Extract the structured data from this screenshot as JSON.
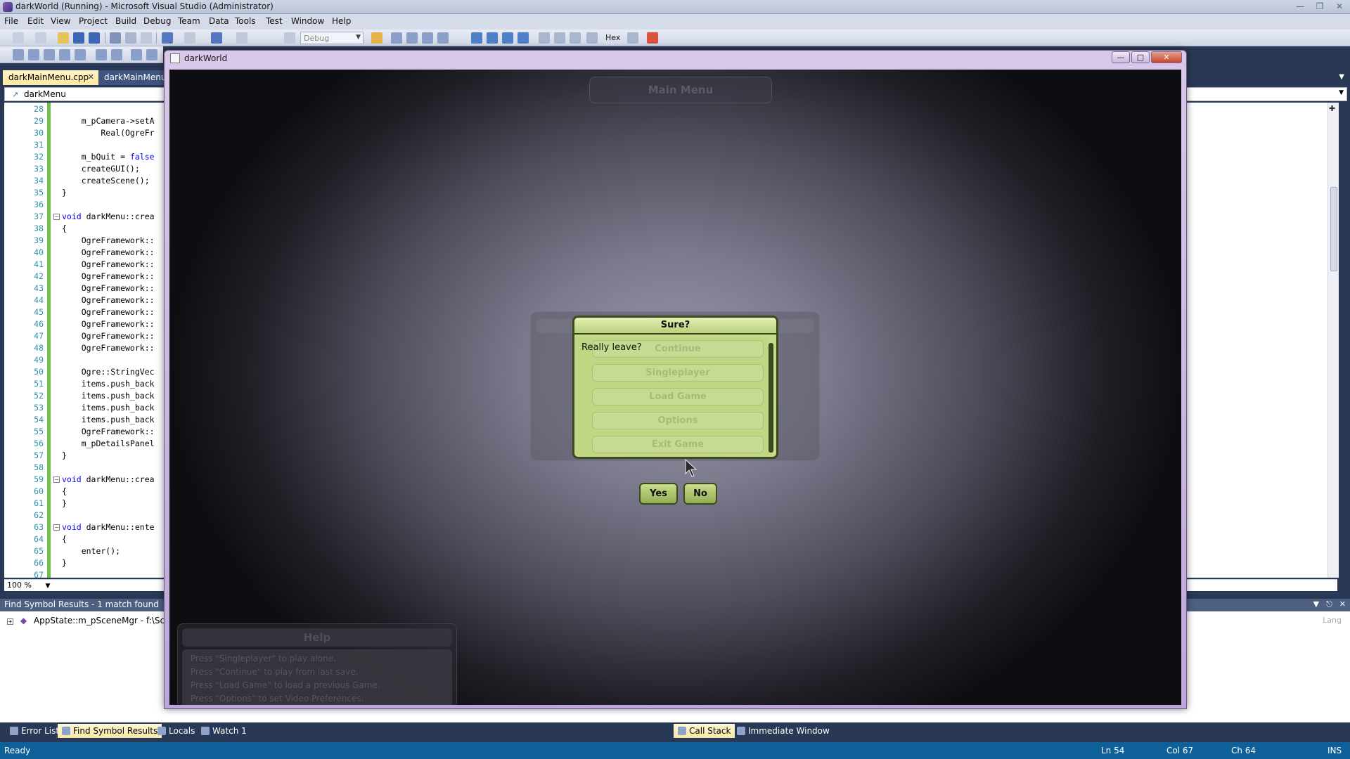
{
  "vs": {
    "title": "darkWorld (Running) - Microsoft Visual Studio (Administrator)",
    "menu": [
      "File",
      "Edit",
      "View",
      "Project",
      "Build",
      "Debug",
      "Team",
      "Data",
      "Tools",
      "Test",
      "Window",
      "Help"
    ],
    "config": "Debug",
    "hex_label": "Hex",
    "tabs": {
      "active": "darkMainMenu.cpp",
      "other": "darkMainMenu.h"
    },
    "nav_bar": "darkMenu",
    "zoom": "100 %",
    "code_lines": [
      {
        "n": "28",
        "text": ""
      },
      {
        "n": "29",
        "text": "    m_pCamera->setA"
      },
      {
        "n": "30",
        "text": "        Real(OgreFr"
      },
      {
        "n": "31",
        "text": ""
      },
      {
        "n": "32",
        "text": "    m_bQuit = false"
      },
      {
        "n": "33",
        "text": "    createGUI();"
      },
      {
        "n": "34",
        "text": "    createScene();"
      },
      {
        "n": "35",
        "text": "}"
      },
      {
        "n": "36",
        "text": ""
      },
      {
        "n": "37",
        "text": "void darkMenu::crea"
      },
      {
        "n": "38",
        "text": "{"
      },
      {
        "n": "39",
        "text": "    OgreFramework::"
      },
      {
        "n": "40",
        "text": "    OgreFramework::"
      },
      {
        "n": "41",
        "text": "    OgreFramework::"
      },
      {
        "n": "42",
        "text": "    OgreFramework::"
      },
      {
        "n": "43",
        "text": "    OgreFramework::"
      },
      {
        "n": "44",
        "text": "    OgreFramework::"
      },
      {
        "n": "45",
        "text": "    OgreFramework::"
      },
      {
        "n": "46",
        "text": "    OgreFramework::"
      },
      {
        "n": "47",
        "text": "    OgreFramework::"
      },
      {
        "n": "48",
        "text": "    OgreFramework::"
      },
      {
        "n": "49",
        "text": ""
      },
      {
        "n": "50",
        "text": "    Ogre::StringVec"
      },
      {
        "n": "51",
        "text": "    items.push_back"
      },
      {
        "n": "52",
        "text": "    items.push_back"
      },
      {
        "n": "53",
        "text": "    items.push_back"
      },
      {
        "n": "54",
        "text": "    items.push_back"
      },
      {
        "n": "55",
        "text": "    OgreFramework::"
      },
      {
        "n": "56",
        "text": "    m_pDetailsPanel"
      },
      {
        "n": "57",
        "text": "}"
      },
      {
        "n": "58",
        "text": ""
      },
      {
        "n": "59",
        "text": "void darkMenu::crea"
      },
      {
        "n": "60",
        "text": "{"
      },
      {
        "n": "61",
        "text": "}"
      },
      {
        "n": "62",
        "text": ""
      },
      {
        "n": "63",
        "text": "void darkMenu::ente"
      },
      {
        "n": "64",
        "text": "{"
      },
      {
        "n": "65",
        "text": "    enter();"
      },
      {
        "n": "66",
        "text": "}"
      },
      {
        "n": "67",
        "text": ""
      }
    ],
    "find_results": {
      "header": "Find Symbol Results - 1 match found",
      "row": "AppState::m_pSceneMgr - f:\\Schoo",
      "lang_col": "Lang"
    },
    "bottom_tabs": [
      "Error List",
      "Find Symbol Results",
      "Locals",
      "Watch 1"
    ],
    "right_tabs": [
      "Call Stack",
      "Immediate Window"
    ],
    "status": {
      "ready": "Ready",
      "ln": "Ln 54",
      "col": "Col 67",
      "ch": "Ch 64",
      "ins": "INS"
    }
  },
  "game": {
    "window_title": "darkWorld",
    "main_menu_title": "Main Menu",
    "dialog": {
      "title": "Sure?",
      "message": "Really leave?",
      "background_items": [
        "Continue",
        "Singleplayer",
        "Load Game",
        "Options",
        "Exit Game"
      ],
      "yes": "Yes",
      "no": "No"
    },
    "help": {
      "title": "Help",
      "lines": [
        "Press \"Singleplayer\" to play alone.",
        "Press \"Continue\" to play from last save.",
        "Press \"Load Game\" to load a previous Game.",
        "Press \"Options\" to set Video Preferences."
      ]
    }
  },
  "colors": {
    "vs_frame": "#293955",
    "dialog_green": "#c6d98a",
    "dialog_border": "#3b4a1c",
    "status_blue": "#0e6198"
  }
}
